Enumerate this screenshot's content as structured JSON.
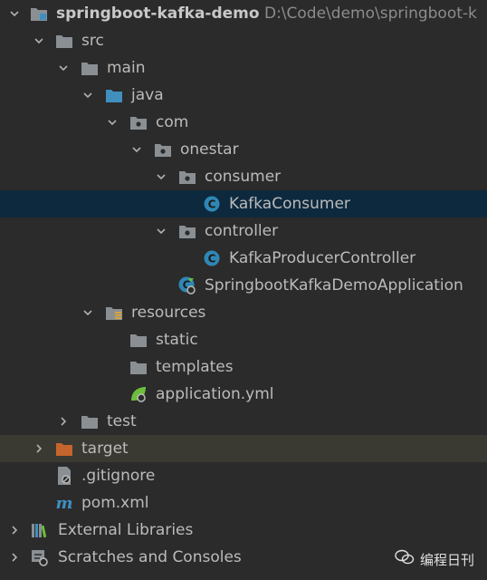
{
  "project": {
    "name": "springboot-kafka-demo",
    "path": "D:\\Code\\demo\\springboot-k"
  },
  "tree": {
    "src": "src",
    "main": "main",
    "java": "java",
    "com": "com",
    "onestar": "onestar",
    "consumer": "consumer",
    "kafka_consumer": "KafkaConsumer",
    "controller": "controller",
    "kafka_producer_controller": "KafkaProducerController",
    "application_class": "SpringbootKafkaDemoApplication",
    "resources": "resources",
    "static": "static",
    "templates": "templates",
    "application_yml": "application.yml",
    "test": "test",
    "target": "target",
    "gitignore": ".gitignore",
    "pom": "pom.xml",
    "external_libraries": "External Libraries",
    "scratches": "Scratches and Consoles"
  },
  "watermark": {
    "text": "编程日刊"
  },
  "colors": {
    "background": "#2b2b2b",
    "selection": "#0d293e",
    "folder": "#8a8f94",
    "source_folder": "#3f8fbf",
    "excluded_folder": "#c5652b",
    "class_icon": "#2f87b5"
  }
}
